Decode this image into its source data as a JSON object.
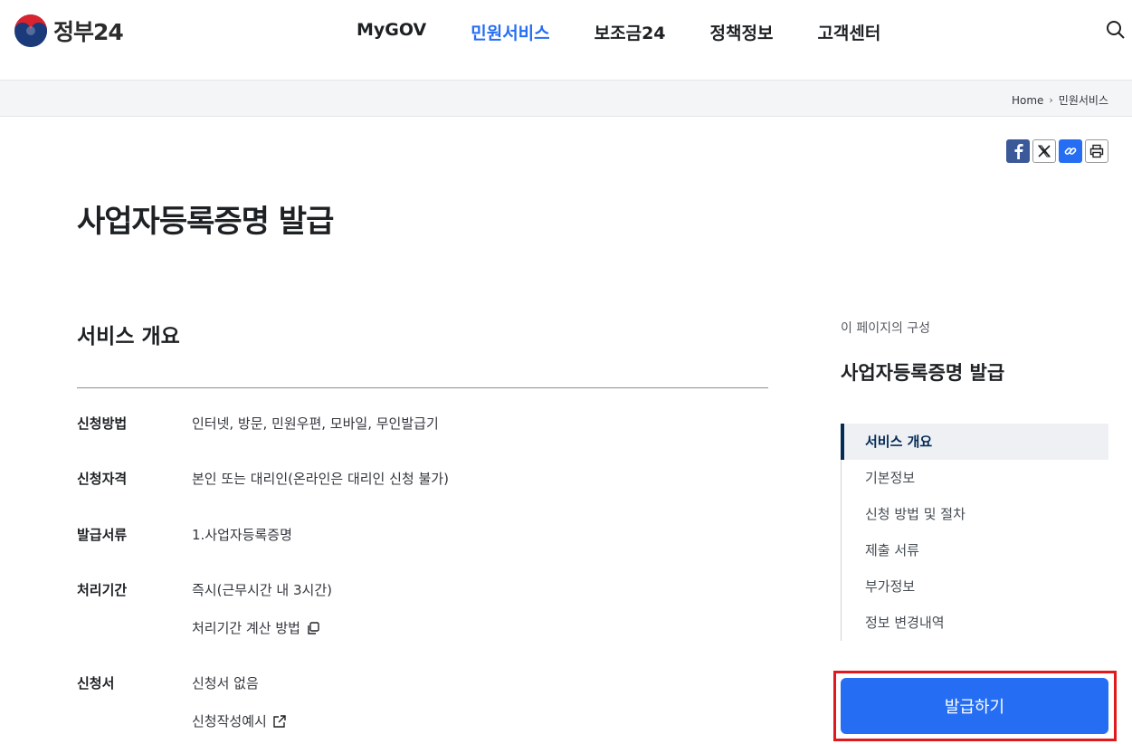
{
  "header": {
    "logo_text": "정부24",
    "nav": [
      "MyGOV",
      "민원서비스",
      "보조금24",
      "정책정보",
      "고객센터"
    ],
    "active_nav": "민원서비스"
  },
  "breadcrumb": {
    "home": "Home",
    "current": "민원서비스"
  },
  "share": {
    "icons": [
      "facebook-icon",
      "x-icon",
      "link-icon",
      "print-icon"
    ]
  },
  "page": {
    "title": "사업자등록증명 발급"
  },
  "overview": {
    "section_title": "서비스 개요",
    "rows": [
      {
        "label": "신청방법",
        "value": "인터넷, 방문, 민원우편, 모바일, 무인발급기"
      },
      {
        "label": "신청자격",
        "value": "본인 또는 대리인(온라인은 대리인 신청 불가)"
      },
      {
        "label": "발급서류",
        "value": "1.사업자등록증명"
      },
      {
        "label": "처리기간",
        "value": "즉시(근무시간 내 3시간)",
        "sub": "처리기간 계산 방법"
      },
      {
        "label": "신청서",
        "value": "신청서 없음",
        "sub": "신청작성예시"
      }
    ]
  },
  "toc": {
    "caption": "이 페이지의 구성",
    "title": "사업자등록증명 발급",
    "items": [
      "서비스 개요",
      "기본정보",
      "신청 방법 및 절차",
      "제출 서류",
      "부가정보",
      "정보 변경내역"
    ],
    "active": "서비스 개요"
  },
  "apply_button": {
    "label": "발급하기"
  },
  "colors": {
    "accent": "#256ef4",
    "toc_active": "#052b57",
    "highlight_frame": "#e0191e"
  }
}
